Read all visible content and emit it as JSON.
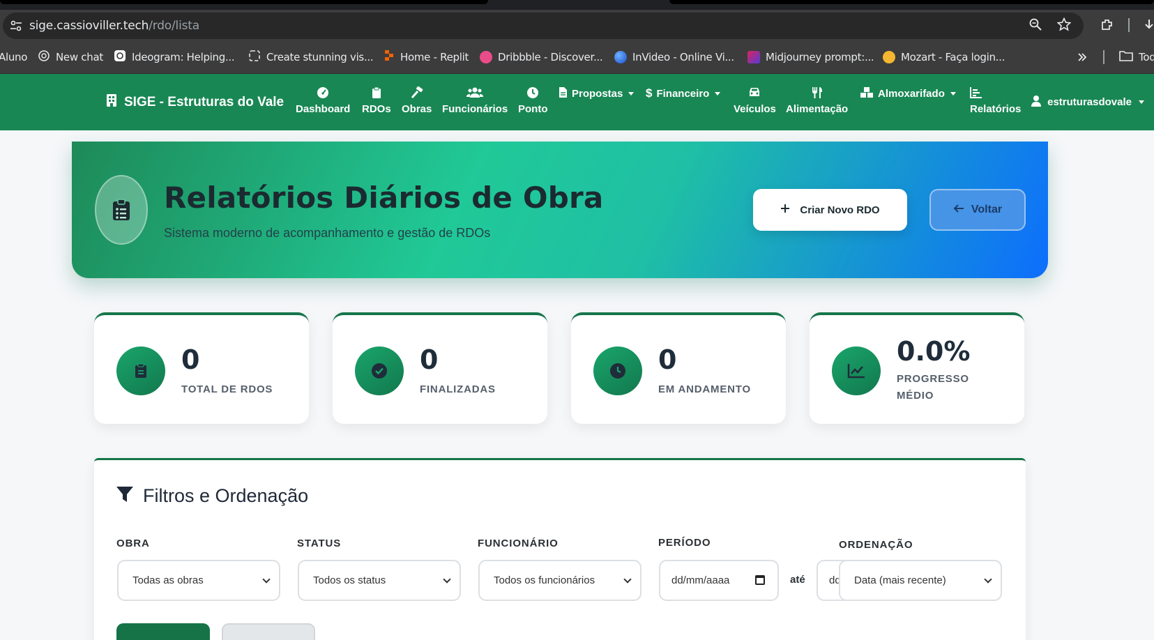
{
  "browser": {
    "url_host": "sige.cassioviller.tech",
    "url_path": "/rdo/lista",
    "bookmarks": [
      {
        "label": "Aluno",
        "color": "#3c3c3c"
      },
      {
        "label": "New chat",
        "color": "#202124"
      },
      {
        "label": "Ideogram: Helping...",
        "color": "#ffffff"
      },
      {
        "label": "Create stunning vis...",
        "color": "#202124"
      },
      {
        "label": "Home - Replit",
        "color": "#f26207"
      },
      {
        "label": "Dribbble - Discover...",
        "color": "#ea4c89"
      },
      {
        "label": "InVideo - Online Vi...",
        "color": "#2f6fe4"
      },
      {
        "label": "Midjourney prompt:...",
        "color": "#d6245a"
      },
      {
        "label": "Mozart - Faça login...",
        "color": "#f5b731"
      },
      {
        "label": "Tod",
        "color": "#3c3c3c"
      }
    ]
  },
  "navbar": {
    "brand": "SIGE - Estruturas do Vale",
    "items": [
      {
        "label": "Dashboard",
        "icon": "gauge-icon"
      },
      {
        "label": "RDOs",
        "icon": "clipboard-icon"
      },
      {
        "label": "Obras",
        "icon": "hammer-icon"
      },
      {
        "label": "Funcionários",
        "icon": "users-icon"
      },
      {
        "label": "Ponto",
        "icon": "clock-icon"
      },
      {
        "label": "Propostas",
        "icon": "file-icon"
      },
      {
        "label": "Financeiro",
        "icon": "dollar-icon"
      },
      {
        "label": "Veículos",
        "icon": "car-icon"
      },
      {
        "label": "Alimentação",
        "icon": "utensils-icon"
      },
      {
        "label": "Almoxarifado",
        "icon": "warehouse-icon"
      },
      {
        "label": "Relatórios",
        "icon": "chart-icon"
      }
    ],
    "user": "estruturasdovale"
  },
  "hero": {
    "title": "Relatórios Diários de Obra",
    "subtitle": "Sistema moderno de acompanhamento e gestão de RDOs",
    "new_button": "Criar Novo RDO",
    "back_button": "Voltar"
  },
  "stats": [
    {
      "value": "0",
      "label": "TOTAL DE RDOS"
    },
    {
      "value": "0",
      "label": "FINALIZADAS"
    },
    {
      "value": "0",
      "label": "EM ANDAMENTO"
    },
    {
      "value": "0.0%",
      "label": "PROGRESSO MÉDIO"
    }
  ],
  "filters": {
    "title": "Filtros e Ordenação",
    "obra_label": "OBRA",
    "obra_value": "Todas as obras",
    "status_label": "STATUS",
    "status_value": "Todos os status",
    "func_label": "FUNCIONÁRIO",
    "func_value": "Todos os funcionários",
    "periodo_label": "PERÍODO",
    "date_placeholder": "dd/mm/aaaa",
    "ate": "até",
    "date_to_partial": "dd",
    "ordem_label": "ORDENAÇÃO",
    "ordem_value": "Data (mais recente)"
  },
  "colors": {
    "nav_green": "#198754",
    "accent_green": "#16754a",
    "hero_blue": "#0d6efd"
  }
}
